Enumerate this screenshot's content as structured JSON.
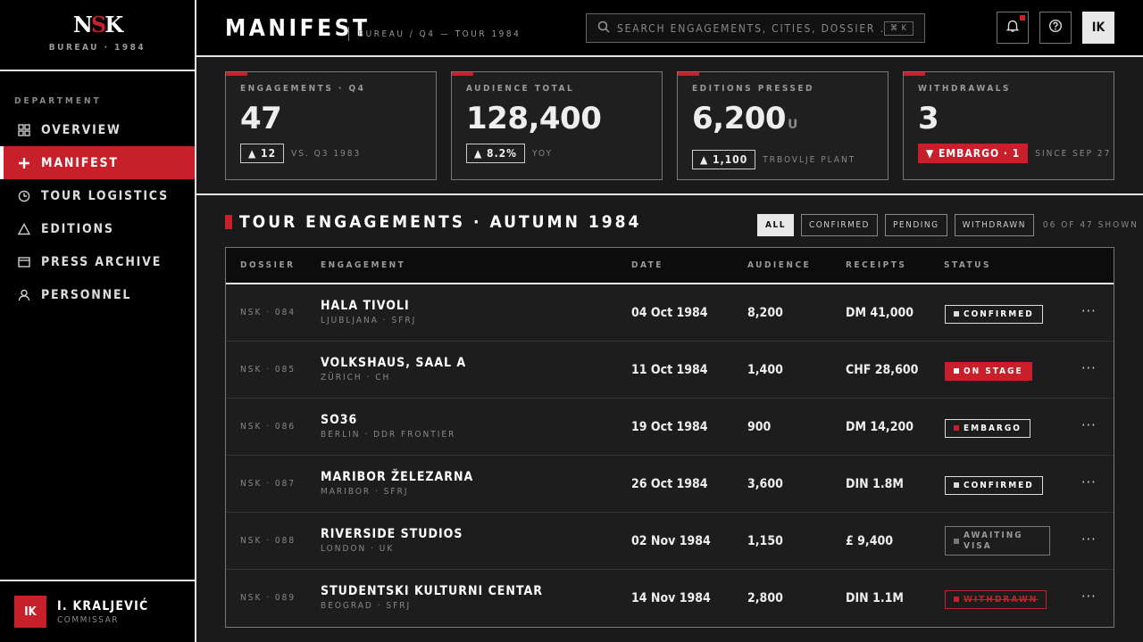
{
  "brand": {
    "logo_a": "N",
    "logo_b": "S",
    "logo_c": "K",
    "subtitle": "BUREAU · 1984"
  },
  "sidebar": {
    "section_label": "DEPARTMENT",
    "items": [
      {
        "label": "OVERVIEW",
        "icon": "grid-icon"
      },
      {
        "label": "MANIFEST",
        "icon": "plus-icon",
        "active": true
      },
      {
        "label": "TOUR LOGISTICS",
        "icon": "clock-icon"
      },
      {
        "label": "EDITIONS",
        "icon": "triangle-icon"
      },
      {
        "label": "PRESS ARCHIVE",
        "icon": "archive-icon"
      },
      {
        "label": "PERSONNEL",
        "icon": "person-icon"
      }
    ]
  },
  "user": {
    "initials": "IK",
    "name": "I. KRALJEVIĆ",
    "role": "COMMISSAR"
  },
  "header": {
    "title": "MANIFEST",
    "breadcrumb": "BUREAU / Q4 — TOUR 1984",
    "search_placeholder": "SEARCH ENGAGEMENTS, CITIES, DOSSIER …",
    "search_shortcut": "⌘ K",
    "avatar_initials": "IK"
  },
  "cards": [
    {
      "label": "ENGAGEMENTS · Q4",
      "value": "47",
      "unit": "",
      "delta": "▲ 12",
      "delta_dir": "up",
      "note": "VS. Q3 1983"
    },
    {
      "label": "AUDIENCE TOTAL",
      "value": "128,400",
      "unit": "",
      "delta": "▲ 8.2%",
      "delta_dir": "up",
      "note": "YOY"
    },
    {
      "label": "EDITIONS PRESSED",
      "value": "6,200",
      "unit": "U",
      "delta": "▲ 1,100",
      "delta_dir": "up",
      "note": "TRBOVLJE PLANT"
    },
    {
      "label": "WITHDRAWALS",
      "value": "3",
      "unit": "",
      "delta": "▼ EMBARGO · 1",
      "delta_dir": "down",
      "note": "SINCE SEP 27"
    }
  ],
  "section": {
    "title": "TOUR ENGAGEMENTS · AUTUMN 1984",
    "filters": [
      "ALL",
      "CONFIRMED",
      "PENDING",
      "WITHDRAWN"
    ],
    "shown": "06 OF 47 SHOWN"
  },
  "table": {
    "headers": [
      "DOSSIER",
      "ENGAGEMENT",
      "DATE",
      "AUDIENCE",
      "RECEIPTS",
      "STATUS"
    ],
    "rows": [
      {
        "dossier": "NSK · 084",
        "venue": "HALA TIVOLI",
        "location": "LJUBLJANA · SFRJ",
        "date": "04 Oct 1984",
        "audience": "8,200",
        "receipts": "DM 41,000",
        "status": "CONFIRMED",
        "status_kind": "confirmed"
      },
      {
        "dossier": "NSK · 085",
        "venue": "VOLKSHAUS, SAAL A",
        "location": "ZÜRICH · CH",
        "date": "11 Oct 1984",
        "audience": "1,400",
        "receipts": "CHF 28,600",
        "status": "ON STAGE",
        "status_kind": "onstage"
      },
      {
        "dossier": "NSK · 086",
        "venue": "SO36",
        "location": "BERLIN · DDR FRONTIER",
        "date": "19 Oct 1984",
        "audience": "900",
        "receipts": "DM 14,200",
        "status": "EMBARGO",
        "status_kind": "embargo"
      },
      {
        "dossier": "NSK · 087",
        "venue": "MARIBOR ŽELEZARNA",
        "location": "MARIBOR · SFRJ",
        "date": "26 Oct 1984",
        "audience": "3,600",
        "receipts": "DIN 1.8M",
        "status": "CONFIRMED",
        "status_kind": "confirmed"
      },
      {
        "dossier": "NSK · 088",
        "venue": "RIVERSIDE STUDIOS",
        "location": "LONDON · UK",
        "date": "02 Nov 1984",
        "audience": "1,150",
        "receipts": "£ 9,400",
        "status": "AWAITING VISA",
        "status_kind": "await"
      },
      {
        "dossier": "NSK · 089",
        "venue": "STUDENTSKI KULTURNI CENTAR",
        "location": "BEOGRAD · SFRJ",
        "date": "14 Nov 1984",
        "audience": "2,800",
        "receipts": "DIN 1.1M",
        "status": "WITHDRAWN",
        "status_kind": "withdrawn"
      }
    ]
  },
  "colors": {
    "accent": "#c8202a",
    "background": "#000000",
    "panel": "#1a1a1a"
  }
}
